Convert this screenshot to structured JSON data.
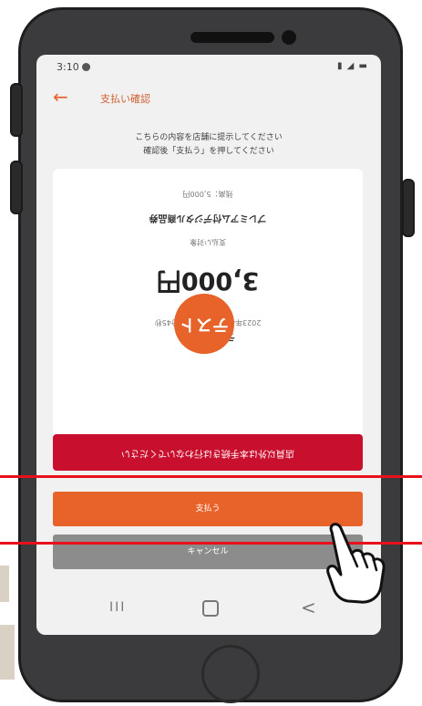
{
  "status_bar": {
    "time": "3:10"
  },
  "app_bar": {
    "title": "支払い確認"
  },
  "notice": {
    "line1": "こちらの内容を店舗に提示してください",
    "line2": "確認後「支払う」を押してください"
  },
  "card": {
    "amount": "3,000円",
    "shop_name": "テスト加盟店",
    "date": "2023年4月17日 18時10分45秒",
    "item_label": "支払い対象",
    "item_name": "プレミアム付デジタル商品券",
    "balance": "残高：5,000円",
    "avatar_text": "テスト"
  },
  "warning": {
    "text": "店員以外は本手続きは行わないでください"
  },
  "buttons": {
    "pay": "支払う",
    "cancel": "キャンセル"
  },
  "nav": {
    "recents": "III",
    "back": "<"
  },
  "colors": {
    "accent": "#e8632a",
    "warning": "#c8102e",
    "highlight_line": "#e8101a",
    "phone_body": "#3b3b3d"
  }
}
